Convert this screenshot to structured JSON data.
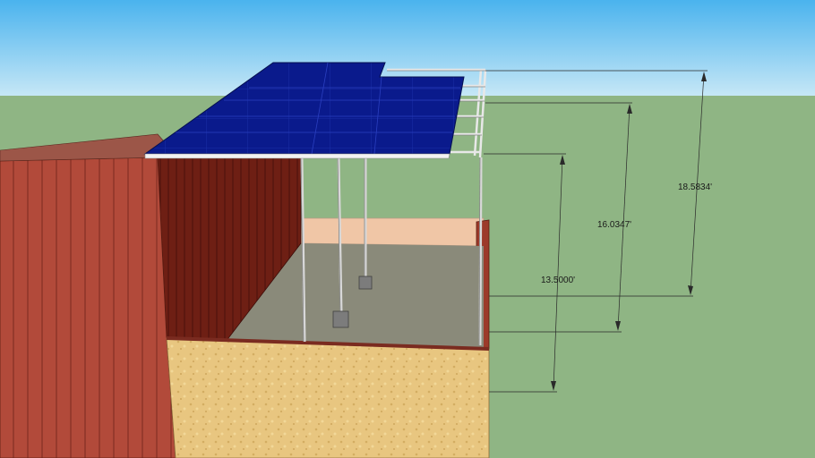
{
  "scene": {
    "sky_color": "#8fd0f2",
    "ground_color": "#8fb584",
    "solar_panel_color": "#0a1a8c",
    "roof_frame_color": "#f2f2f2",
    "building_siding_color": "#b24a3a",
    "interior_wall_color": "#6e1f14",
    "back_wall_color": "#f0c6a6",
    "floor_color": "#8a8a7a",
    "foundation_color": "#e8c680",
    "post_color": "#e6e6e6",
    "footing_color": "#7c7c7c"
  },
  "dimensions": {
    "height_1": "18.5834'",
    "height_2": "16.0347'",
    "height_3": "13.5000'"
  }
}
